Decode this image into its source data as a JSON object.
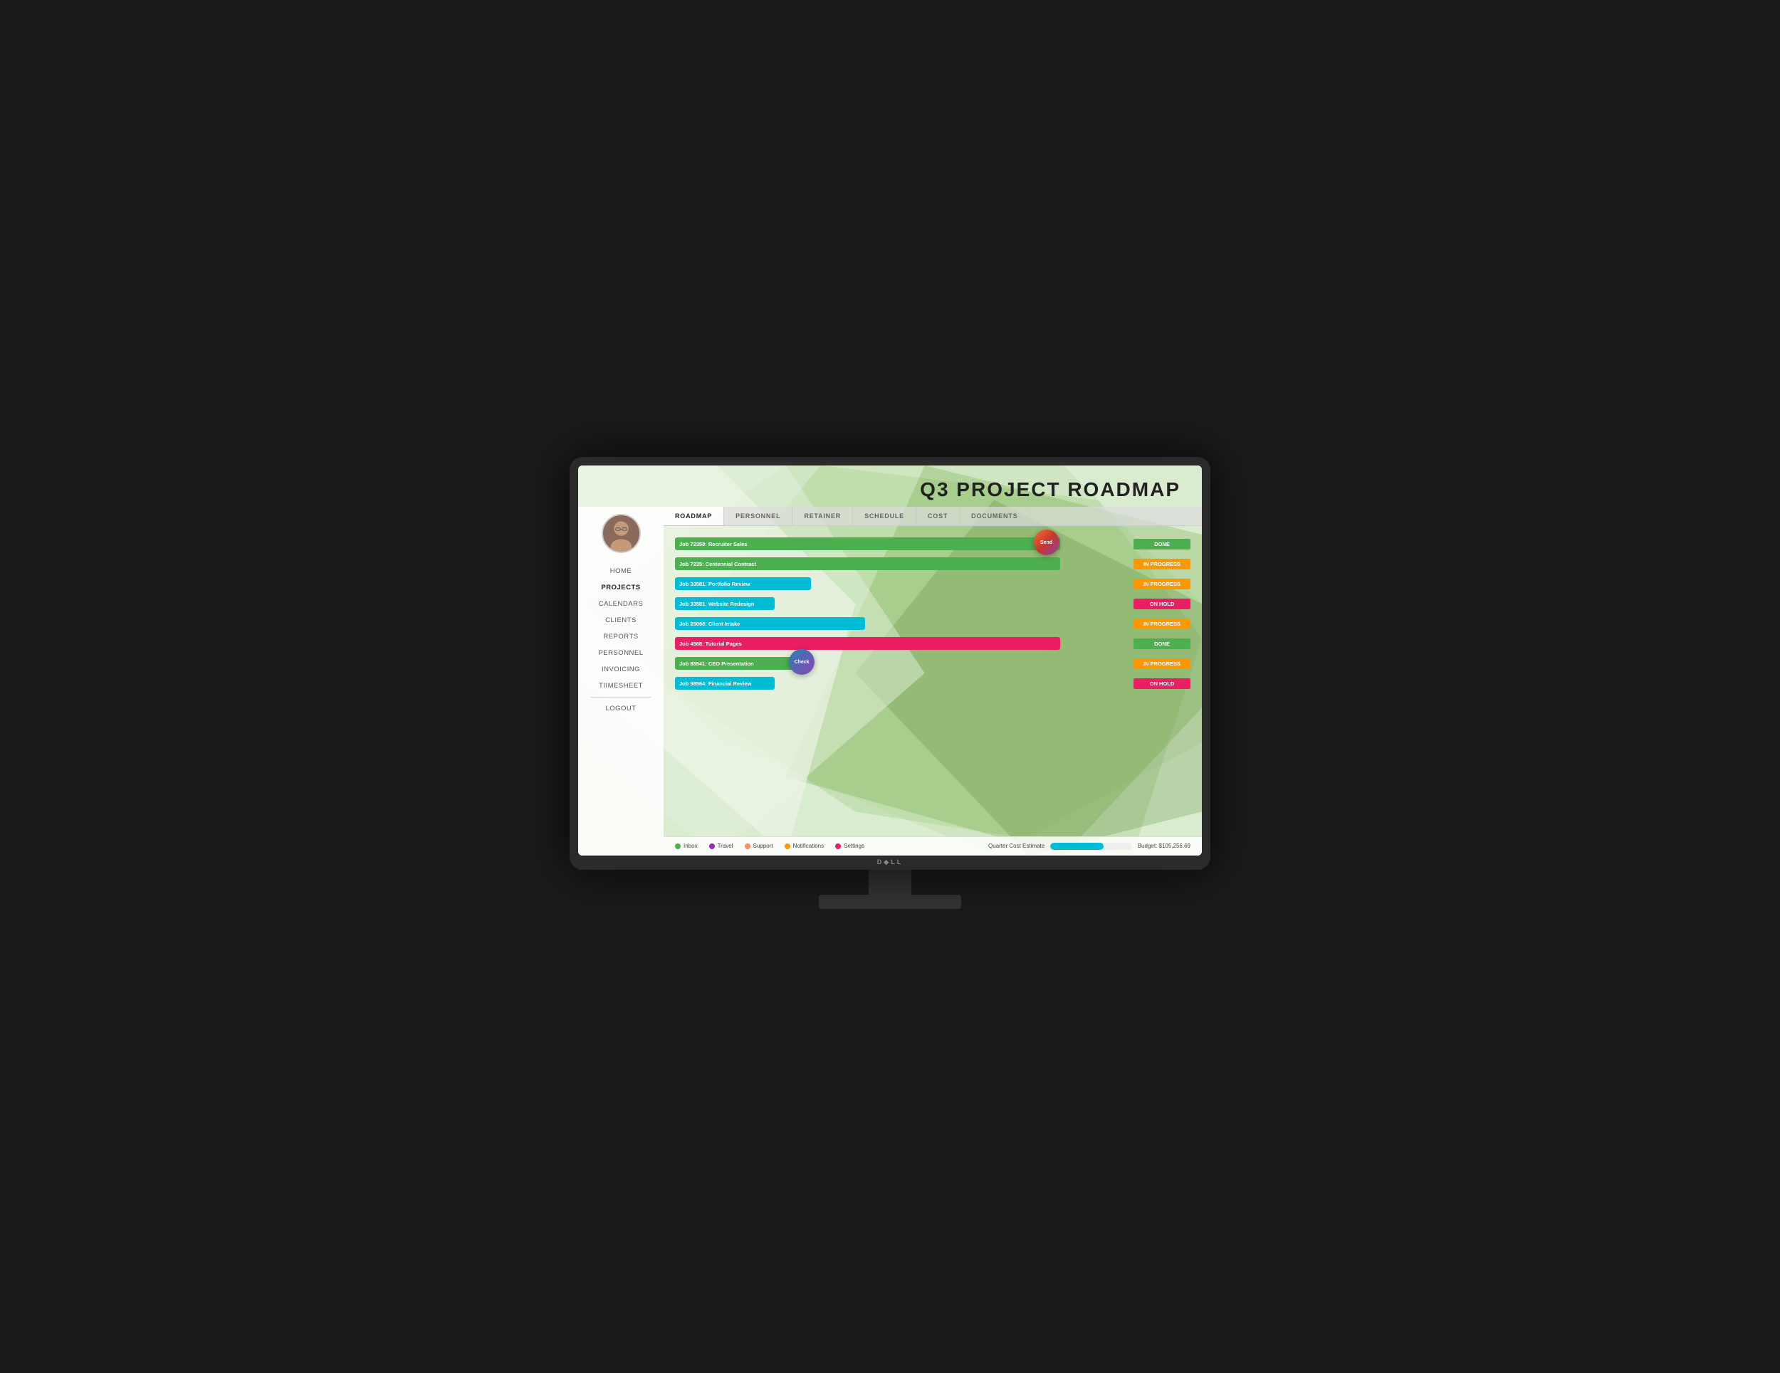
{
  "header": {
    "title": "Q3 PROJECT ROADMAP"
  },
  "tabs": [
    {
      "id": "roadmap",
      "label": "ROADMAP",
      "active": true
    },
    {
      "id": "personnel",
      "label": "PERSONNEL",
      "active": false
    },
    {
      "id": "retainer",
      "label": "RETAINER",
      "active": false
    },
    {
      "id": "schedule",
      "label": "SCHEDULE",
      "active": false
    },
    {
      "id": "cost",
      "label": "COST",
      "active": false
    },
    {
      "id": "documents",
      "label": "DOCUMENTS",
      "active": false
    }
  ],
  "nav": {
    "items": [
      {
        "id": "home",
        "label": "HOME",
        "active": false
      },
      {
        "id": "projects",
        "label": "PROJECTS",
        "active": true
      },
      {
        "id": "calendars",
        "label": "CALENDARS",
        "active": false
      },
      {
        "id": "clients",
        "label": "CLIENTS",
        "active": false
      },
      {
        "id": "reports",
        "label": "REPORTS",
        "active": false
      },
      {
        "id": "personnel",
        "label": "PERSONNEL",
        "active": false
      },
      {
        "id": "invoicing",
        "label": "INVOICING",
        "active": false
      },
      {
        "id": "timesheet",
        "label": "TIIMESHEET",
        "active": false
      },
      {
        "id": "logout",
        "label": "LOGOUT",
        "active": false
      }
    ]
  },
  "gantt": {
    "markers": [
      {
        "id": "send",
        "label": "Send",
        "color": "gradient-warm"
      },
      {
        "id": "check",
        "label": "Check",
        "color": "gradient-cool"
      }
    ],
    "rows": [
      {
        "id": "job-72358",
        "label": "Job 72358: Recruiter Sales",
        "bar_left": "0%",
        "bar_width": "85%",
        "bar_color": "#4caf50",
        "status": "DONE",
        "status_color": "#4caf50"
      },
      {
        "id": "job-7235",
        "label": "Job 7235: Centennial Contract",
        "bar_left": "0%",
        "bar_width": "85%",
        "bar_color": "#4caf50",
        "status": "IN PROGRESS",
        "status_color": "#ff9800"
      },
      {
        "id": "job-33581-portfolio",
        "label": "Job 33581: Portfolio Review",
        "bar_left": "0%",
        "bar_width": "30%",
        "bar_color": "#00bcd4",
        "status": "IN PROGRESS",
        "status_color": "#ff9800"
      },
      {
        "id": "job-33581-website",
        "label": "Job 33581: Website Redesign",
        "bar_left": "0%",
        "bar_width": "22%",
        "bar_color": "#00bcd4",
        "status": "ON HOLD",
        "status_color": "#e91e63"
      },
      {
        "id": "job-25098",
        "label": "Job 25098: Client Intake",
        "bar_left": "0%",
        "bar_width": "42%",
        "bar_color": "#00bcd4",
        "status": "IN PROGRESS",
        "status_color": "#ff9800"
      },
      {
        "id": "job-4568",
        "label": "Job 4568: Tutorial Pages",
        "bar_left": "0%",
        "bar_width": "85%",
        "bar_color": "#e91e63",
        "status": "DONE",
        "status_color": "#4caf50"
      },
      {
        "id": "job-85541",
        "label": "Job 85541: CEO Presentation",
        "bar_left": "0%",
        "bar_width": "30%",
        "bar_color": "#4caf50",
        "status": "IN PROGRESS",
        "status_color": "#ff9800"
      },
      {
        "id": "job-98564",
        "label": "Job 98564: Financial Review",
        "bar_left": "0%",
        "bar_width": "22%",
        "bar_color": "#00bcd4",
        "status": "ON HOLD",
        "status_color": "#e91e63"
      }
    ]
  },
  "status_bar": {
    "items": [
      {
        "id": "inbox",
        "label": "Inbox",
        "color": "#4caf50"
      },
      {
        "id": "travel",
        "label": "Travel",
        "color": "#9c27b0"
      },
      {
        "id": "support",
        "label": "Support",
        "color": "#ff8a65"
      },
      {
        "id": "notifications",
        "label": "Notifications",
        "color": "#ff9800"
      },
      {
        "id": "settings",
        "label": "Settings",
        "color": "#e91e63"
      }
    ],
    "cost_estimate": {
      "label": "Quarter Cost Estimate",
      "fill_percent": 65,
      "fill_color": "#00bcd4",
      "budget_label": "Budget: $105,256.69"
    }
  },
  "dell_logo": "D◆LL"
}
